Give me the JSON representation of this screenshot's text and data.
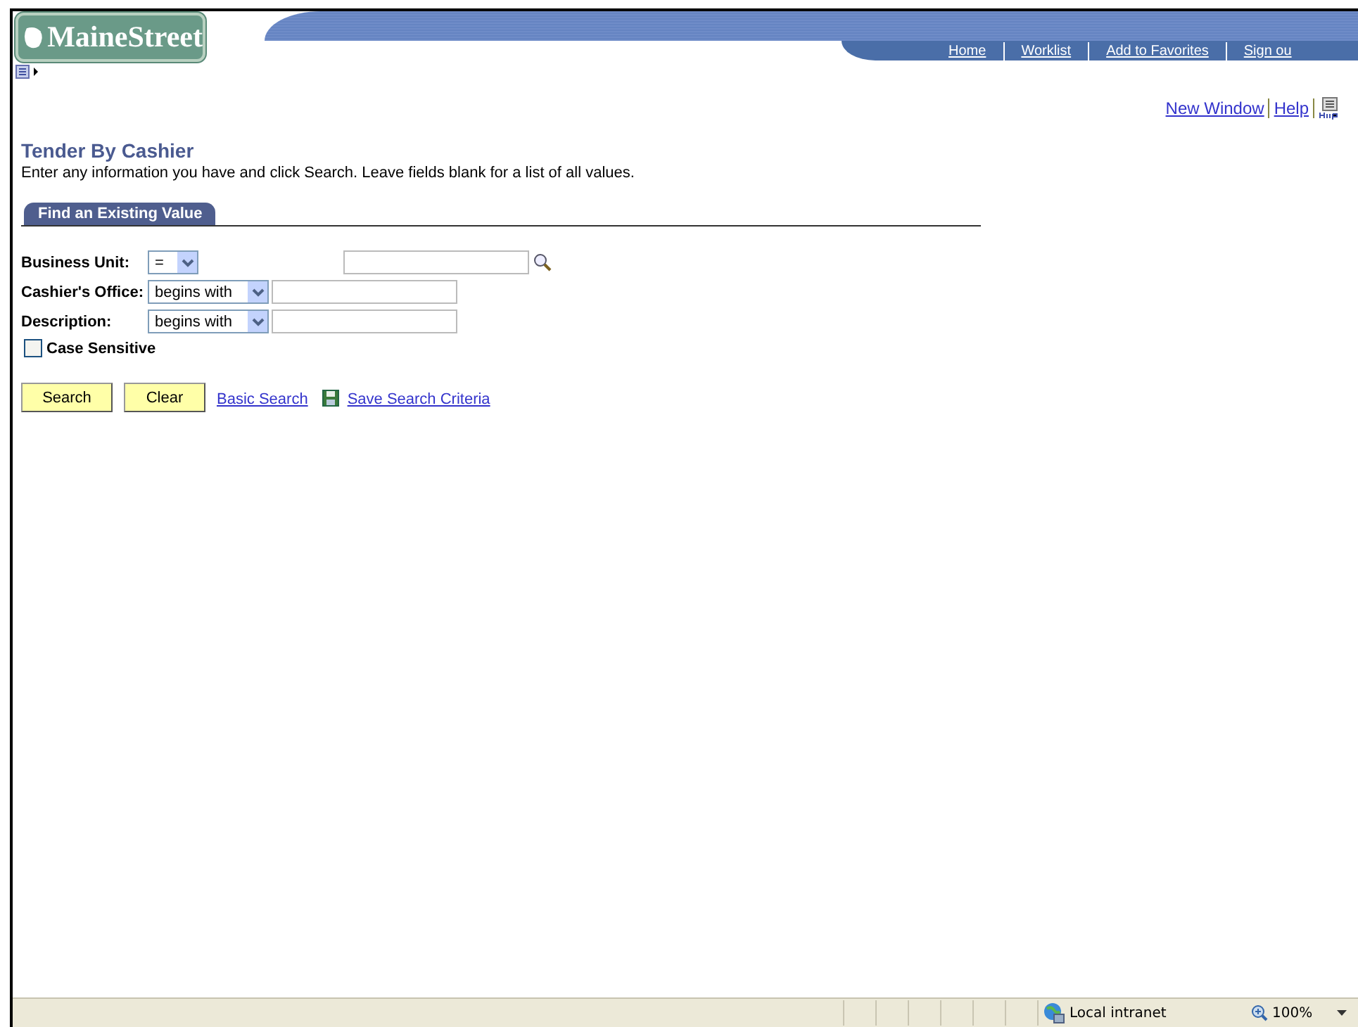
{
  "logo": {
    "text": "MaineStreet"
  },
  "nav_links": [
    "Home",
    "Worklist",
    "Add to Favorites",
    "Sign ou"
  ],
  "utility_links": [
    "New Window",
    "Help"
  ],
  "page": {
    "title": "Tender By Cashier",
    "instructions": "Enter any information you have and click Search. Leave fields blank for a list of all values."
  },
  "tabs": [
    {
      "label": "Find an Existing Value",
      "selected": true
    }
  ],
  "criteria": [
    {
      "kind": "lookup",
      "label": "Business Unit:",
      "operator": "="
    },
    {
      "kind": "text",
      "label": "Cashier's Office:",
      "operator": "begins with"
    },
    {
      "kind": "text",
      "label": "Description:",
      "operator": "begins with"
    }
  ],
  "case_sensitive": {
    "label": "Case Sensitive",
    "checked": false
  },
  "buttons": [
    "Search",
    "Clear"
  ],
  "links": [
    "Basic Search",
    "Save Search Criteria"
  ],
  "status_bar": {
    "zone": "Local intranet",
    "zoom": "100%"
  }
}
